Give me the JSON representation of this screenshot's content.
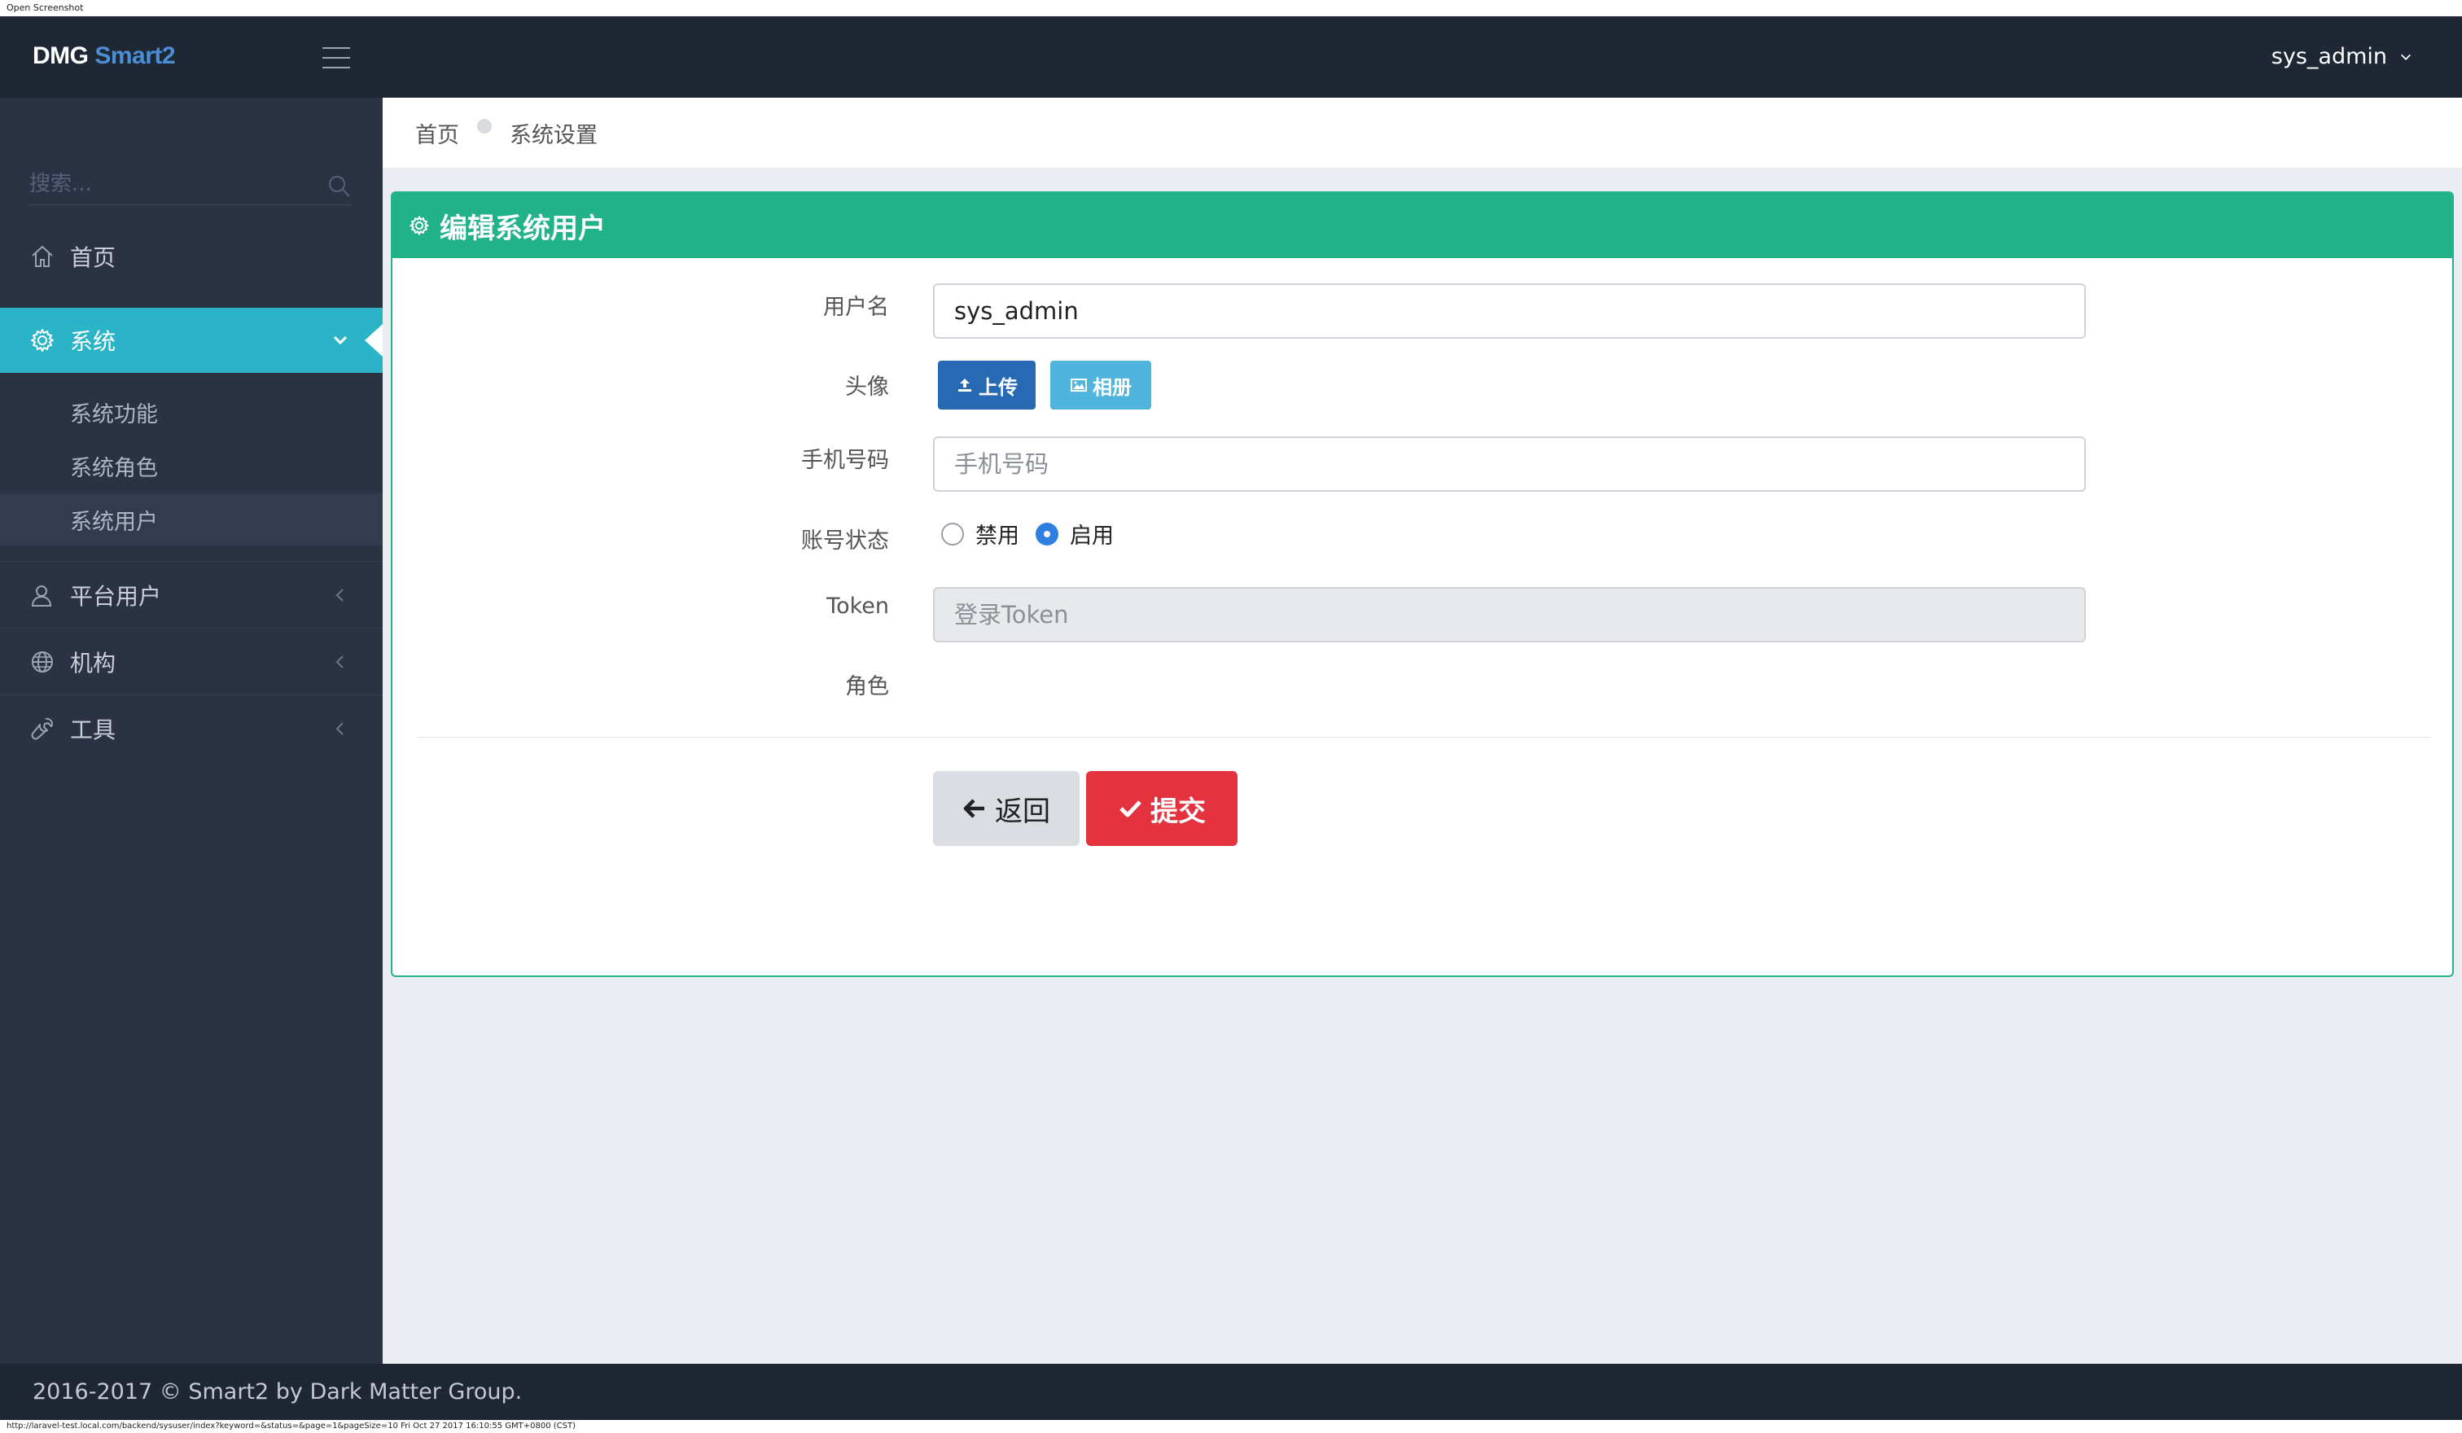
{
  "window": {
    "caption": "Open Screenshot"
  },
  "status_url": "http://laravel-test.local.com/backend/sysuser/index?keyword=&status=&page=1&pageSize=10 Fri Oct 27 2017 16:10:55 GMT+0800 (CST)",
  "topbar": {
    "brand_main": "DMG",
    "brand_accent": "Smart2",
    "brand_accent_color": "#4a8fd4",
    "menu_icon": "hamburger-icon",
    "user": "sys_admin",
    "user_caret_icon": "chevron-down-icon"
  },
  "sidebar": {
    "search_placeholder": "搜索...",
    "search_icon": "search-icon",
    "items": [
      {
        "label": "首页",
        "icon": "home-icon"
      },
      {
        "label": "系统",
        "icon": "gear-icon",
        "active": true
      },
      {
        "label": "平台用户",
        "icon": "user-icon"
      },
      {
        "label": "机构",
        "icon": "globe-icon"
      },
      {
        "label": "工具",
        "icon": "wrench-icon"
      }
    ],
    "sub_items": [
      {
        "label": "系统功能"
      },
      {
        "label": "系统角色"
      },
      {
        "label": "系统用户",
        "current": true
      }
    ],
    "active_color": "#2bb4c7"
  },
  "breadcrumb": {
    "home": "首页",
    "current": "系统设置"
  },
  "panel": {
    "title": "编辑系统用户",
    "title_icon": "gear-icon",
    "header_color": "#22b28a",
    "fields": {
      "username": {
        "label": "用户名",
        "value": "sys_admin"
      },
      "avatar": {
        "label": "头像",
        "upload_label": "上传",
        "album_label": "相册"
      },
      "phone": {
        "label": "手机号码",
        "placeholder": "手机号码"
      },
      "status": {
        "label": "账号状态",
        "option_disabled": "禁用",
        "option_enabled": "启用",
        "selected": "启用"
      },
      "token": {
        "label": "Token",
        "placeholder": "登录Token"
      },
      "role": {
        "label": "角色"
      }
    },
    "actions": {
      "back_label": "返回",
      "submit_label": "提交",
      "submit_color": "#e5323f"
    }
  },
  "footer": {
    "text": "2016-2017 © Smart2 by Dark Matter Group."
  }
}
